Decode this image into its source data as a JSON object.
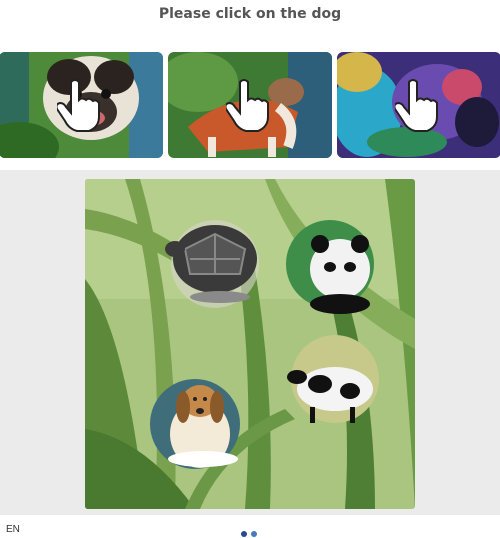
{
  "title": "Please click on the dog",
  "examples": [
    {
      "name": "example-dog-1",
      "icon": "hand-pointer-icon"
    },
    {
      "name": "example-dog-2",
      "icon": "hand-pointer-icon"
    },
    {
      "name": "example-dog-3",
      "icon": "hand-pointer-icon"
    }
  ],
  "challenge": {
    "items": [
      "turtle",
      "panda",
      "cow",
      "dog"
    ],
    "colors": {
      "panel": "#ebebeb",
      "background": "#a9c57f",
      "leaf": "#5d8a3a"
    }
  },
  "footer": {
    "language": "EN"
  }
}
